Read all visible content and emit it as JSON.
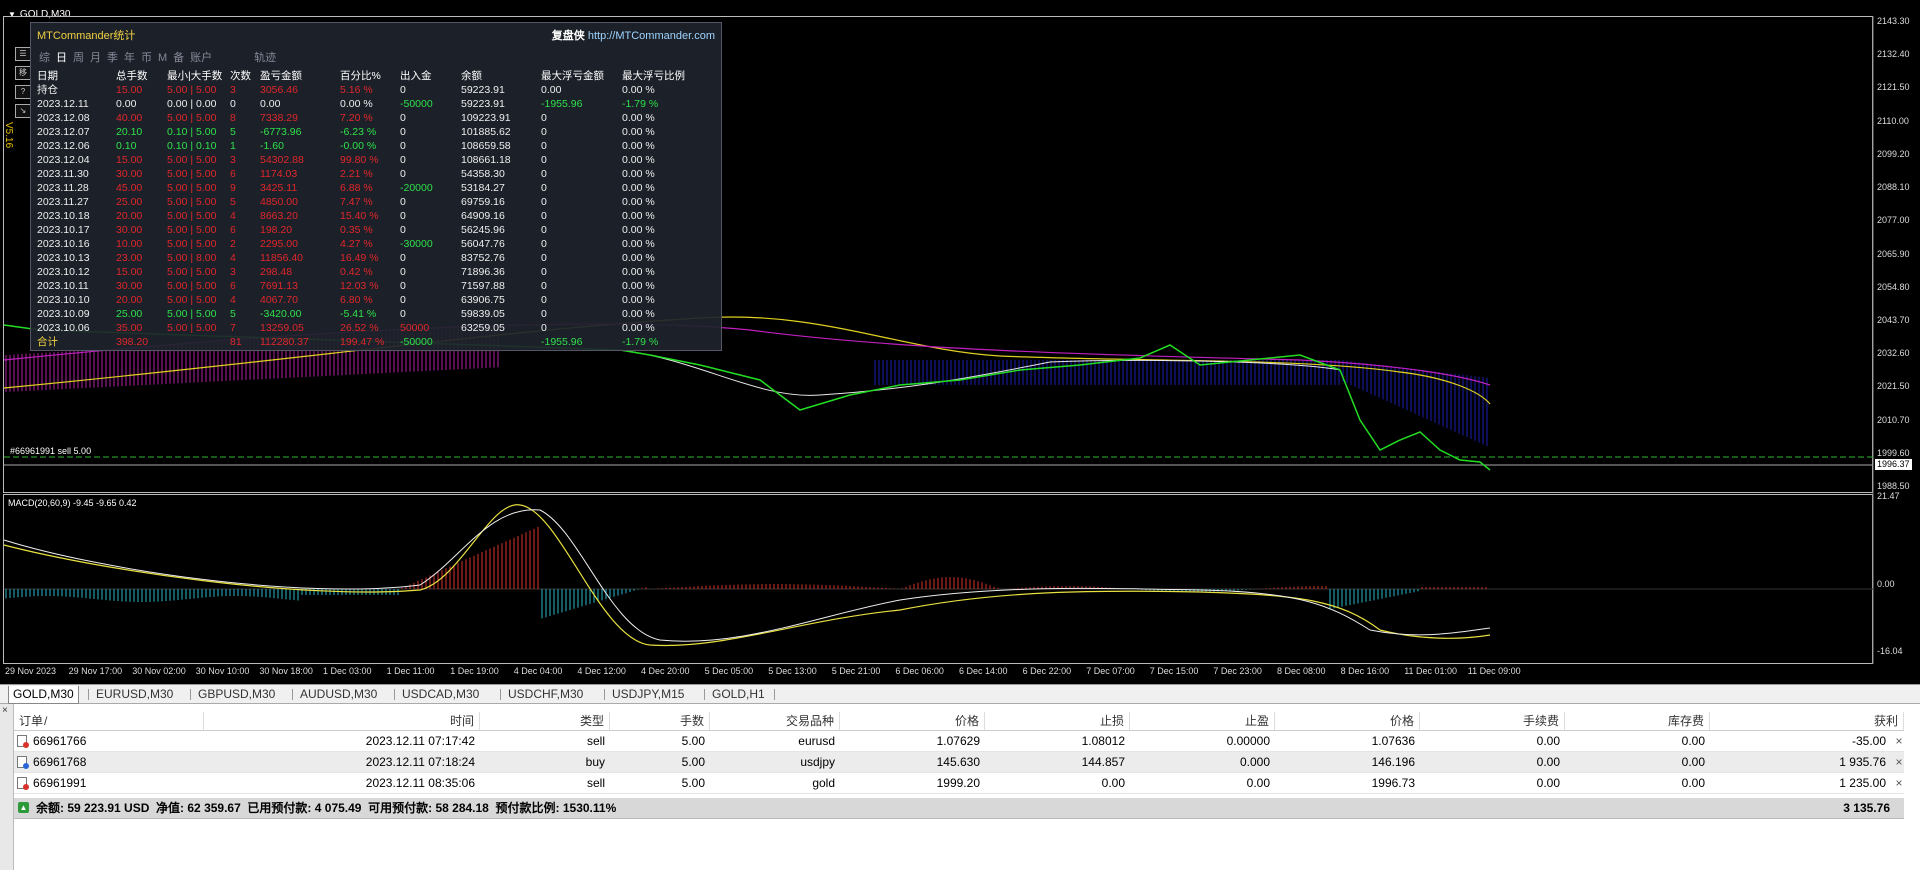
{
  "window": {
    "title": "GOLD,M30"
  },
  "chart": {
    "price_scale": [
      "2143.30",
      "2132.40",
      "2121.50",
      "2110.00",
      "2099.20",
      "2088.10",
      "2077.00",
      "2065.90",
      "2054.80",
      "2043.70",
      "2032.60",
      "2021.50",
      "2010.70",
      "1999.60",
      "1988.50"
    ],
    "current_price": "1996.37",
    "order_line_label": "#66961991 sell 5.00",
    "macd_title": "MACD(20,60,9) -9.45 -9.65 0.42",
    "macd_scale": [
      "21.47",
      "0.00",
      "-16.04"
    ],
    "time_labels": [
      "29 Nov 2023",
      "29 Nov 17:00",
      "30 Nov 02:00",
      "30 Nov 10:00",
      "30 Nov 18:00",
      "1 Dec 03:00",
      "1 Dec 11:00",
      "1 Dec 19:00",
      "4 Dec 04:00",
      "4 Dec 12:00",
      "4 Dec 20:00",
      "5 Dec 05:00",
      "5 Dec 13:00",
      "5 Dec 21:00",
      "6 Dec 06:00",
      "6 Dec 14:00",
      "6 Dec 22:00",
      "7 Dec 07:00",
      "7 Dec 15:00",
      "7 Dec 23:00",
      "8 Dec 08:00",
      "8 Dec 16:00",
      "11 Dec 01:00",
      "11 Dec 09:00"
    ],
    "side_buttons": [
      "☰",
      "移",
      "?",
      "↘"
    ],
    "version": "V5.16"
  },
  "stats": {
    "title": "MTCommander统计",
    "brand": "复盘侠",
    "url": "http://MTCommander.com",
    "tabs": [
      "综",
      "日",
      "周",
      "月",
      "季",
      "年",
      "币",
      "M",
      "备",
      "账户",
      "轨迹"
    ],
    "active_tab": "日",
    "headers": [
      "日期",
      "总手数",
      "最小|大手数",
      "次数",
      "盈亏金额",
      "百分比%",
      "出入金",
      "余额",
      "最大浮亏金额",
      "最大浮亏比例"
    ],
    "rows": [
      [
        "持仓",
        "15.00",
        "5.00 | 5.00",
        "3",
        "3056.46",
        "5.16 %",
        "0",
        "59223.91",
        "0.00",
        "0.00 %"
      ],
      [
        "2023.12.11",
        "0.00",
        "0.00 | 0.00",
        "0",
        "0.00",
        "0.00 %",
        "-50000",
        "59223.91",
        "-1955.96",
        "-1.79 %"
      ],
      [
        "2023.12.08",
        "40.00",
        "5.00 | 5.00",
        "8",
        "7338.29",
        "7.20 %",
        "0",
        "109223.91",
        "0",
        "0.00 %"
      ],
      [
        "2023.12.07",
        "20.10",
        "0.10 | 5.00",
        "5",
        "-6773.96",
        "-6.23 %",
        "0",
        "101885.62",
        "0",
        "0.00 %"
      ],
      [
        "2023.12.06",
        "0.10",
        "0.10 | 0.10",
        "1",
        "-1.60",
        "-0.00 %",
        "0",
        "108659.58",
        "0",
        "0.00 %"
      ],
      [
        "2023.12.04",
        "15.00",
        "5.00 | 5.00",
        "3",
        "54302.88",
        "99.80 %",
        "0",
        "108661.18",
        "0",
        "0.00 %"
      ],
      [
        "2023.11.30",
        "30.00",
        "5.00 | 5.00",
        "6",
        "1174.03",
        "2.21 %",
        "0",
        "54358.30",
        "0",
        "0.00 %"
      ],
      [
        "2023.11.28",
        "45.00",
        "5.00 | 5.00",
        "9",
        "3425.11",
        "6.88 %",
        "-20000",
        "53184.27",
        "0",
        "0.00 %"
      ],
      [
        "2023.11.27",
        "25.00",
        "5.00 | 5.00",
        "5",
        "4850.00",
        "7.47 %",
        "0",
        "69759.16",
        "0",
        "0.00 %"
      ],
      [
        "2023.10.18",
        "20.00",
        "5.00 | 5.00",
        "4",
        "8663.20",
        "15.40 %",
        "0",
        "64909.16",
        "0",
        "0.00 %"
      ],
      [
        "2023.10.17",
        "30.00",
        "5.00 | 5.00",
        "6",
        "198.20",
        "0.35 %",
        "0",
        "56245.96",
        "0",
        "0.00 %"
      ],
      [
        "2023.10.16",
        "10.00",
        "5.00 | 5.00",
        "2",
        "2295.00",
        "4.27 %",
        "-30000",
        "56047.76",
        "0",
        "0.00 %"
      ],
      [
        "2023.10.13",
        "23.00",
        "5.00 | 8.00",
        "4",
        "11856.40",
        "16.49 %",
        "0",
        "83752.76",
        "0",
        "0.00 %"
      ],
      [
        "2023.10.12",
        "15.00",
        "5.00 | 5.00",
        "3",
        "298.48",
        "0.42 %",
        "0",
        "71896.36",
        "0",
        "0.00 %"
      ],
      [
        "2023.10.11",
        "30.00",
        "5.00 | 5.00",
        "6",
        "7691.13",
        "12.03 %",
        "0",
        "71597.88",
        "0",
        "0.00 %"
      ],
      [
        "2023.10.10",
        "20.00",
        "5.00 | 5.00",
        "4",
        "4067.70",
        "6.80 %",
        "0",
        "63906.75",
        "0",
        "0.00 %"
      ],
      [
        "2023.10.09",
        "25.00",
        "5.00 | 5.00",
        "5",
        "-3420.00",
        "-5.41 %",
        "0",
        "59839.05",
        "0",
        "0.00 %"
      ],
      [
        "2023.10.06",
        "35.00",
        "5.00 | 5.00",
        "7",
        "13259.05",
        "26.52 %",
        "50000",
        "63259.05",
        "0",
        "0.00 %"
      ],
      [
        "合计",
        "398.20",
        "",
        "81",
        "112280.37",
        "199.47 %",
        "-50000",
        "",
        "-1955.96",
        "-1.79 %"
      ]
    ],
    "colors": {
      "loss": "#2ee04a",
      "profit": "#e0262a",
      "header": "#ffffff",
      "title": "#f0d040"
    }
  },
  "tabs": [
    "GOLD,M30",
    "EURUSD,M30",
    "GBPUSD,M30",
    "AUDUSD,M30",
    "USDCAD,M30",
    "USDCHF,M30",
    "USDJPY,M15",
    "GOLD,H1"
  ],
  "terminal": {
    "close_label": "×",
    "columns": [
      "订单",
      "/",
      "时间",
      "类型",
      "手数",
      "交易品种",
      "价格",
      "止损",
      "止盈",
      "价格",
      "手续费",
      "库存费",
      "获利"
    ],
    "orders": [
      {
        "ticket": "66961766",
        "time": "2023.12.11 07:17:42",
        "type": "sell",
        "lots": "5.00",
        "symbol": "eurusd",
        "open_price": "1.07629",
        "sl": "1.08012",
        "tp": "0.00000",
        "price": "1.07636",
        "commission": "0.00",
        "swap": "0.00",
        "profit": "-35.00",
        "close": "×"
      },
      {
        "ticket": "66961768",
        "time": "2023.12.11 07:18:24",
        "type": "buy",
        "lots": "5.00",
        "symbol": "usdjpy",
        "open_price": "145.630",
        "sl": "144.857",
        "tp": "0.000",
        "price": "146.196",
        "commission": "0.00",
        "swap": "0.00",
        "profit": "1 935.76",
        "close": "×"
      },
      {
        "ticket": "66961991",
        "time": "2023.12.11 08:35:06",
        "type": "sell",
        "lots": "5.00",
        "symbol": "gold",
        "open_price": "1999.20",
        "sl": "0.00",
        "tp": "0.00",
        "price": "1996.73",
        "commission": "0.00",
        "swap": "0.00",
        "profit": "1 235.00",
        "close": "×"
      }
    ],
    "summary": "余额: 59 223.91 USD  净值: 62 359.67  已用预付款: 4 075.49  可用预付款: 58 284.18  预付款比例: 1530.11%",
    "total_profit": "3 135.76"
  }
}
